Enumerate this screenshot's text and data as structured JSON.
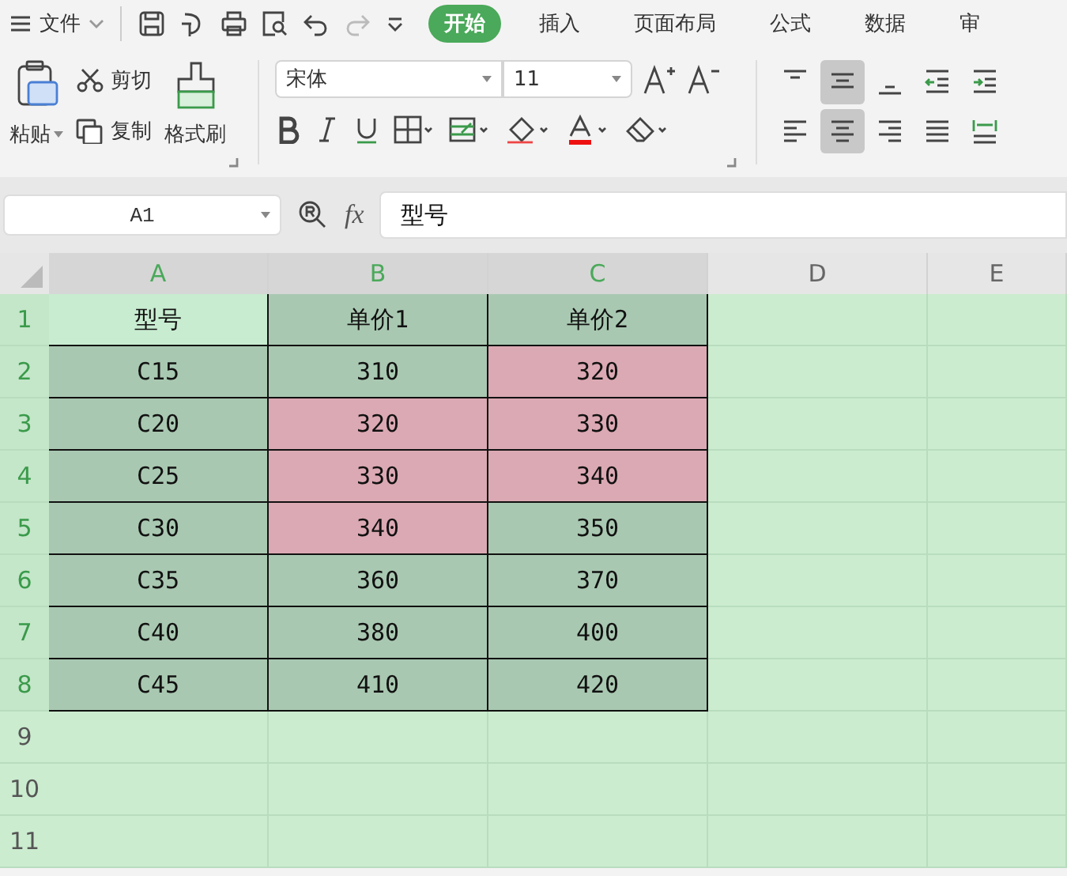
{
  "menu": {
    "label": "文件"
  },
  "tabs": [
    {
      "label": "开始",
      "selected": true
    },
    {
      "label": "插入",
      "selected": false
    },
    {
      "label": "页面布局",
      "selected": false
    },
    {
      "label": "公式",
      "selected": false
    },
    {
      "label": "数据",
      "selected": false
    },
    {
      "label": "审",
      "selected": false
    }
  ],
  "clipboard": {
    "paste": "粘贴",
    "cut": "剪切",
    "copy": "复制",
    "format_painter": "格式刷"
  },
  "font": {
    "name": "宋体",
    "size": "11"
  },
  "align_buttons": [
    {
      "selected": false
    },
    {
      "selected": true
    },
    {
      "selected": false
    },
    {
      "selected": false
    },
    {
      "selected": false
    },
    {
      "selected": false
    },
    {
      "selected": true
    },
    {
      "selected": false
    },
    {
      "selected": false
    },
    {
      "selected": false
    }
  ],
  "name_box": {
    "value": "A1"
  },
  "formula_bar": {
    "function_label": "fx",
    "value": "型号"
  },
  "columns": [
    {
      "label": "A",
      "selected": true
    },
    {
      "label": "B",
      "selected": true
    },
    {
      "label": "C",
      "selected": true
    },
    {
      "label": "D",
      "selected": false
    },
    {
      "label": "E",
      "selected": false
    }
  ],
  "rows": [
    {
      "label": "1",
      "selected": true,
      "cells": [
        {
          "text": "型号",
          "highlighted": false
        },
        {
          "text": "单价1",
          "highlighted": false
        },
        {
          "text": "单价2",
          "highlighted": false
        }
      ]
    },
    {
      "label": "2",
      "selected": true,
      "cells": [
        {
          "text": "C15",
          "highlighted": false
        },
        {
          "text": "310",
          "highlighted": false
        },
        {
          "text": "320",
          "highlighted": true
        }
      ]
    },
    {
      "label": "3",
      "selected": true,
      "cells": [
        {
          "text": "C20",
          "highlighted": false
        },
        {
          "text": "320",
          "highlighted": true
        },
        {
          "text": "330",
          "highlighted": true
        }
      ]
    },
    {
      "label": "4",
      "selected": true,
      "cells": [
        {
          "text": "C25",
          "highlighted": false
        },
        {
          "text": "330",
          "highlighted": true
        },
        {
          "text": "340",
          "highlighted": true
        }
      ]
    },
    {
      "label": "5",
      "selected": true,
      "cells": [
        {
          "text": "C30",
          "highlighted": false
        },
        {
          "text": "340",
          "highlighted": true
        },
        {
          "text": "350",
          "highlighted": false
        }
      ]
    },
    {
      "label": "6",
      "selected": true,
      "cells": [
        {
          "text": "C35",
          "highlighted": false
        },
        {
          "text": "360",
          "highlighted": false
        },
        {
          "text": "370",
          "highlighted": false
        }
      ]
    },
    {
      "label": "7",
      "selected": true,
      "cells": [
        {
          "text": "C40",
          "highlighted": false
        },
        {
          "text": "380",
          "highlighted": false
        },
        {
          "text": "400",
          "highlighted": false
        }
      ]
    },
    {
      "label": "8",
      "selected": true,
      "cells": [
        {
          "text": "C45",
          "highlighted": false
        },
        {
          "text": "410",
          "highlighted": false
        },
        {
          "text": "420",
          "highlighted": false
        }
      ]
    },
    {
      "label": "9",
      "selected": false,
      "cells": []
    },
    {
      "label": "10",
      "selected": false,
      "cells": []
    },
    {
      "label": "11",
      "selected": false,
      "cells": []
    }
  ]
}
